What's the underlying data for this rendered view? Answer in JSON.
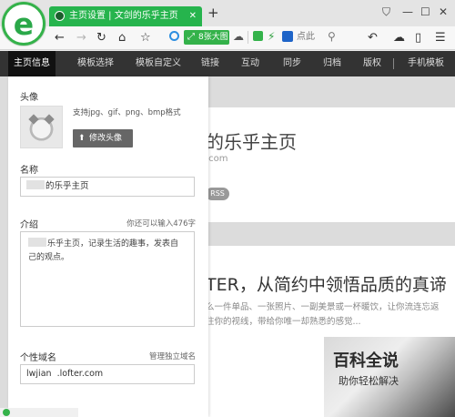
{
  "browser": {
    "logo_letter": "e",
    "tab_title": "主页设置 | 文剑的乐乎主页",
    "tab_close": "✕",
    "new_tab": "+",
    "window_controls": [
      "⛉",
      "—",
      "☐",
      "✕"
    ],
    "nav_icons": [
      "←",
      "→",
      "↻",
      "⌂",
      "☆"
    ],
    "address_pill": "8张大图",
    "search_text": "点此",
    "right_icons": [
      "↶",
      "☁",
      "▯",
      "☰"
    ]
  },
  "site_nav": {
    "items": [
      "主页信息",
      "模板选择",
      "模板自定义",
      "链接",
      "互动",
      "同步",
      "归档",
      "版权",
      "手机模板"
    ],
    "active_index": 0
  },
  "settings": {
    "avatar_label": "头像",
    "format_hint": "支持jpg、gif、png、bmp格式",
    "change_avatar_button": "修改头像",
    "change_avatar_icon": "⬆",
    "name_label": "名称",
    "name_value": "的乐乎主页",
    "intro_label": "介绍",
    "intro_count": "你还可以输入476字",
    "intro_line1": "乐乎主页，记录生活的趣事，发表自",
    "intro_line2": "己的观点。",
    "domain_label": "个性域名",
    "domain_manage_link": "管理独立域名",
    "domain_value": "lwjian  .lofter.com"
  },
  "background_page": {
    "title": "的乐乎主页",
    "url": ".com",
    "rss": "RSS",
    "article_title": "TER，从简约中领悟品质的真谛",
    "snippet_line1": "么一件单品、一张照片、一副美景或一杯暖饮，让你流连忘返",
    "snippet_line2": "住你的视线，带给你唯一却熟悉的感觉..."
  },
  "watermark": {
    "title": "百科全说",
    "subtitle": "助你轻松解决"
  },
  "colors": {
    "accent_green": "#26b44d",
    "nav_dark": "#333333",
    "nav_active": "#111111"
  }
}
